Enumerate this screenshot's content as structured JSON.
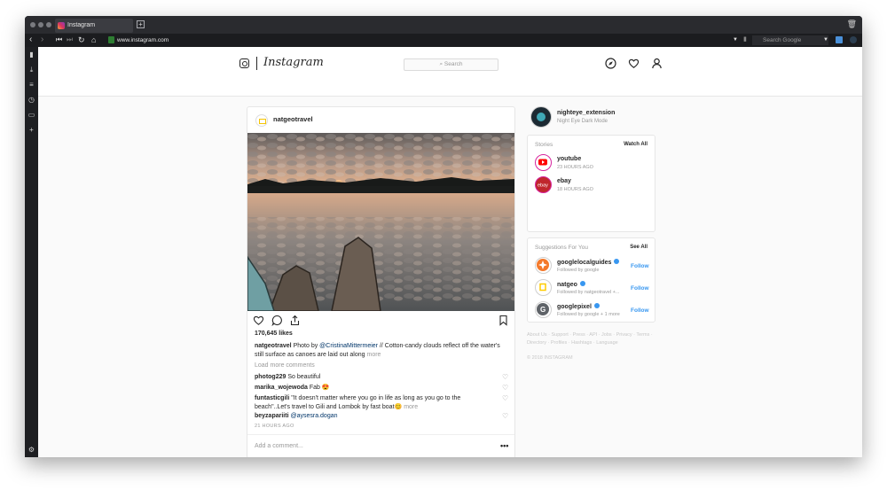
{
  "browser": {
    "tab_title": "Instagram",
    "url": "www.instagram.com",
    "search_placeholder": "Search Google"
  },
  "header": {
    "wordmark": "Instagram",
    "search_placeholder": "Search",
    "icons": [
      "compass-icon",
      "heart-icon",
      "person-icon"
    ]
  },
  "post": {
    "username": "natgeotravel",
    "likes": "170,645 likes",
    "caption_user": "natgeotravel",
    "caption_prefix": "Photo by",
    "caption_mention": "@CristinaMittermeier",
    "caption_text": "// Cotton-candy clouds reflect off the water's still surface as canoes are laid out along",
    "caption_more": "more",
    "load_more": "Load more comments",
    "comments": [
      {
        "user": "photog229",
        "text": "So beautiful"
      },
      {
        "user": "marika_wojewoda",
        "text": "Fab 😍"
      },
      {
        "user": "funtasticgili",
        "text": "\"It doesn't matter where you go in life as long as you go to the beach\"..Let's travel to Gili and Lombok by fast boat😊",
        "more": "more"
      },
      {
        "user": "beyzapariiti",
        "text": "@aysesra.dogan"
      }
    ],
    "timestamp": "21 HOURS AGO",
    "add_comment_placeholder": "Add a comment...",
    "more_dots": "•••"
  },
  "profile": {
    "username": "nighteye_extension",
    "fullname": "Night Eye Dark Mode"
  },
  "stories": {
    "title": "Stories",
    "action": "Watch All",
    "items": [
      {
        "name": "youtube",
        "time": "23 HOURS AGO",
        "color": "#ff0000"
      },
      {
        "name": "ebay",
        "time": "18 HOURS AGO",
        "color": "#c0272d"
      }
    ]
  },
  "suggestions": {
    "title": "Suggestions For You",
    "action": "See All",
    "items": [
      {
        "name": "googlelocalguides",
        "sub": "Followed by google",
        "follow": "Follow",
        "color": "#f4792b"
      },
      {
        "name": "natgeo",
        "sub": "Followed by natgeotravel +...",
        "follow": "Follow",
        "color": "#ffcc00"
      },
      {
        "name": "googlepixel",
        "sub": "Followed by google + 1 more",
        "follow": "Follow",
        "color": "#5f6368"
      }
    ]
  },
  "footer": {
    "links": "About Us · Support · Press · API · Jobs · Privacy · Terms · Directory · Profiles · Hashtags · Language",
    "copyright": "© 2018 INSTAGRAM"
  }
}
